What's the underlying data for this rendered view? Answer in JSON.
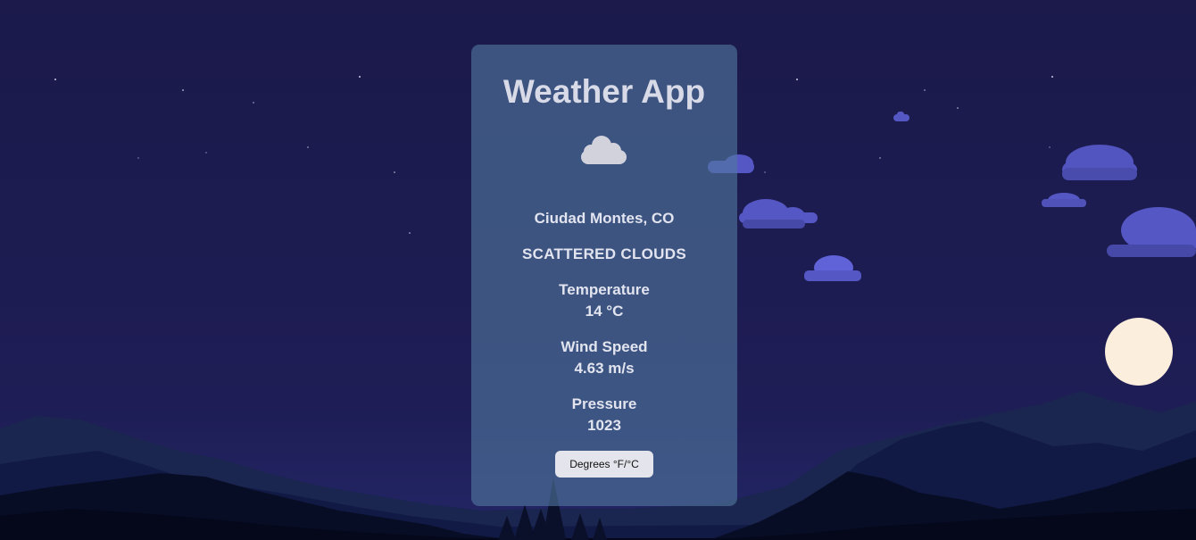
{
  "app": {
    "title": "Weather App"
  },
  "weather": {
    "icon": "cloud-icon",
    "location": "Ciudad Montes, CO",
    "description": "SCATTERED CLOUDS",
    "temperature": {
      "label": "Temperature",
      "value": "14 °C"
    },
    "wind_speed": {
      "label": "Wind Speed",
      "value": "4.63 m/s"
    },
    "pressure": {
      "label": "Pressure",
      "value": "1023"
    }
  },
  "controls": {
    "unit_toggle_label": "Degrees °F/°C"
  },
  "colors": {
    "sky": "#1c1a4c",
    "card": "#50789e",
    "cloud": "#5a5cc8",
    "moon": "#fbeedc",
    "mountain_far": "#1b2650",
    "mountain_near": "#0b1130"
  }
}
